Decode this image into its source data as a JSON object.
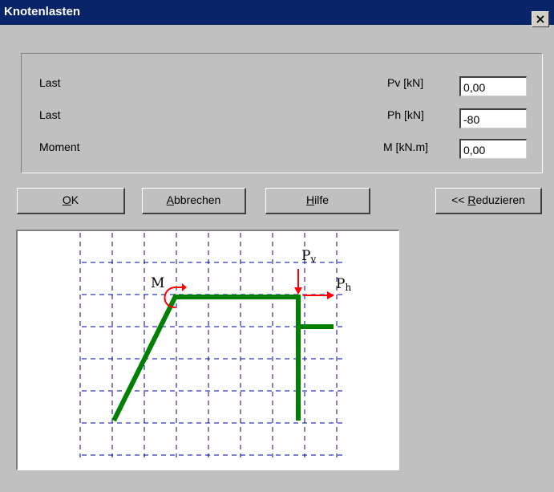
{
  "window": {
    "title": "Knotenlasten",
    "close_glyph": "×"
  },
  "fields": [
    {
      "label": "Last",
      "unit": "Pv [kN]",
      "value": "0,00"
    },
    {
      "label": "Last",
      "unit": "Ph [kN]",
      "value": "-80"
    },
    {
      "label": "Moment",
      "unit": "M [kN.m]",
      "value": "0,00"
    }
  ],
  "buttons": {
    "ok": {
      "accel": "O",
      "rest": "K"
    },
    "cancel": {
      "accel": "A",
      "rest": "bbrechen"
    },
    "help": {
      "accel": "H",
      "rest": "ilfe"
    },
    "reduce": {
      "prefix": "<< ",
      "accel": "R",
      "rest": "eduzieren"
    }
  },
  "diagram": {
    "moment_label": "M",
    "pv_label": "P",
    "pv_sub": "v",
    "ph_label": "P",
    "ph_sub": "h",
    "colors": {
      "grid": "#0000a0",
      "frame": "#008000",
      "force": "#ff0000"
    }
  }
}
